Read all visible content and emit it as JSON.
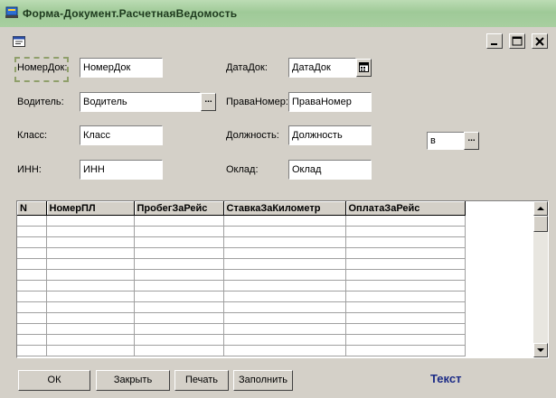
{
  "window": {
    "title": "Форма-Документ.РасчетнаяВедомость",
    "accent": "#1c2b86",
    "titlebar_color": "#a8cfa0"
  },
  "form": {
    "nomer_label": "НомерДок:",
    "nomer_value": "НомерДок",
    "data_label": "ДатаДок:",
    "data_value": "ДатаДок",
    "voditel_label": "Водитель:",
    "voditel_value": "Водитель",
    "prava_label": "ПраваНомер:",
    "prava_value": "ПраваНомер",
    "klass_label": "Класс:",
    "klass_value": "Класс",
    "dolzh_label": "Должность:",
    "dolzh_value": "Должность",
    "inn_label": "ИНН:",
    "inn_value": "ИНН",
    "oklad_label": "Оклад:",
    "oklad_value": "Оклад",
    "extra_value": "в",
    "ellipsis": "..."
  },
  "table": {
    "columns": [
      "N",
      "НомерПЛ",
      "ПробегЗаРейс",
      "СтавкаЗаКилометр",
      "ОплатаЗаРейс"
    ]
  },
  "buttons": {
    "ok": "ОК",
    "close": "Закрыть",
    "print": "Печать",
    "fill": "Заполнить"
  },
  "footer_text": "Текст",
  "icons": [
    "document-icon",
    "form-icon",
    "minimize-icon",
    "maximize-icon",
    "close-icon",
    "calendar-icon",
    "scroll-up-icon",
    "scroll-down-icon"
  ]
}
